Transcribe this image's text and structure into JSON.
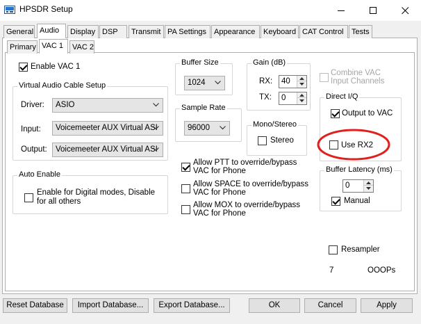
{
  "window": {
    "title": "HPSDR Setup"
  },
  "colors": {
    "annotation_circle": "#e0201c"
  },
  "main_tabs": [
    "General",
    "Audio",
    "Display",
    "DSP",
    "Transmit",
    "PA Settings",
    "Appearance",
    "Keyboard",
    "CAT Control",
    "Tests"
  ],
  "sub_tabs": [
    "Primary",
    "VAC 1",
    "VAC 2"
  ],
  "vac1": {
    "enable_label": "Enable VAC 1",
    "cable_group": "Virtual Audio Cable Setup",
    "driver_label": "Driver:",
    "driver_value": "ASIO",
    "input_label": "Input:",
    "input_value": "Voicemeeter AUX Virtual ASI",
    "output_label": "Output:",
    "output_value": "Voicemeeter AUX Virtual ASI",
    "auto_enable_group": "Auto Enable",
    "auto_enable_line1": "Enable for Digital modes, Disable",
    "auto_enable_line2": "for all others",
    "buffer_size_group": "Buffer Size",
    "buffer_size_value": "1024",
    "sample_rate_group": "Sample Rate",
    "sample_rate_value": "96000",
    "gain_group": "Gain (dB)",
    "rx_label": "RX:",
    "rx_value": "40",
    "tx_label": "TX:",
    "tx_value": "0",
    "mono_stereo_group": "Mono/Stereo",
    "stereo_label": "Stereo",
    "ptt_line1": "Allow PTT to override/bypass",
    "ptt_line2": "VAC for Phone",
    "space_line1": "Allow SPACE to override/bypass",
    "space_line2": "VAC for Phone",
    "mox_line1": "Allow MOX to override/bypass",
    "mox_line2": "VAC for Phone",
    "combine_line1": "Combine VAC",
    "combine_line2": "Input Channels",
    "direct_iq_group": "Direct I/Q",
    "output_to_vac_label": "Output to VAC",
    "use_rx2_label": "Use RX2",
    "buffer_latency_group": "Buffer Latency (ms)",
    "latency_value": "0",
    "manual_label": "Manual",
    "resampler_label": "Resampler",
    "counter_value": "7",
    "ooops_label": "OOOPs"
  },
  "footer": {
    "reset": "Reset Database",
    "import": "Import Database...",
    "export": "Export Database...",
    "ok": "OK",
    "cancel": "Cancel",
    "apply": "Apply"
  }
}
